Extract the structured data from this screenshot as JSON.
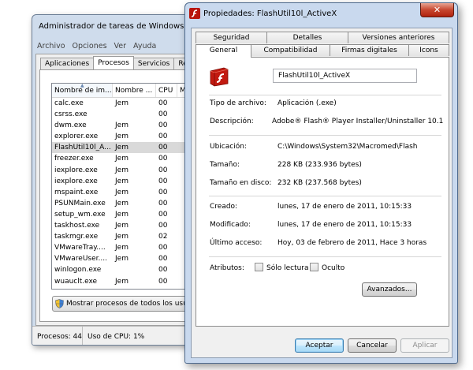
{
  "task_manager": {
    "title": "Administrador de tareas de Windows",
    "menu": [
      "Archivo",
      "Opciones",
      "Ver",
      "Ayuda"
    ],
    "tabs": [
      "Aplicaciones",
      "Procesos",
      "Servicios",
      "Rendim"
    ],
    "active_tab": "Procesos",
    "columns": [
      "Nombre de im...",
      "Nombre ...",
      "CPU",
      "M"
    ],
    "rows": [
      {
        "name": "calc.exe",
        "user": "Jem",
        "cpu": "00"
      },
      {
        "name": "csrss.exe",
        "user": "",
        "cpu": "00"
      },
      {
        "name": "dwm.exe",
        "user": "Jem",
        "cpu": "00"
      },
      {
        "name": "explorer.exe",
        "user": "Jem",
        "cpu": "00"
      },
      {
        "name": "FlashUtil10l_A...",
        "user": "Jem",
        "cpu": "00"
      },
      {
        "name": "freezer.exe",
        "user": "Jem",
        "cpu": "00"
      },
      {
        "name": "iexplore.exe",
        "user": "Jem",
        "cpu": "00"
      },
      {
        "name": "iexplore.exe",
        "user": "Jem",
        "cpu": "00"
      },
      {
        "name": "mspaint.exe",
        "user": "Jem",
        "cpu": "00"
      },
      {
        "name": "PSUNMain.exe",
        "user": "Jem",
        "cpu": "00"
      },
      {
        "name": "setup_wm.exe",
        "user": "Jem",
        "cpu": "00"
      },
      {
        "name": "taskhost.exe",
        "user": "Jem",
        "cpu": "00"
      },
      {
        "name": "taskmgr.exe",
        "user": "Jem",
        "cpu": "02"
      },
      {
        "name": "VMwareTray....",
        "user": "Jem",
        "cpu": "00"
      },
      {
        "name": "VMwareUser....",
        "user": "Jem",
        "cpu": "00"
      },
      {
        "name": "winlogon.exe",
        "user": "",
        "cpu": "00"
      },
      {
        "name": "wuauclt.exe",
        "user": "Jem",
        "cpu": "00"
      }
    ],
    "selected_row": 4,
    "show_all_button": "Mostrar procesos de todos los usuarios",
    "status": {
      "processes": "Procesos: 44",
      "cpu": "Uso de CPU: 1%"
    }
  },
  "properties": {
    "title": "Propiedades: FlashUtil10l_ActiveX",
    "close_glyph": "✕",
    "tabs_row1": [
      "Seguridad",
      "Detalles",
      "Versiones anteriores"
    ],
    "tabs_row2": [
      "General",
      "Compatibilidad",
      "Firmas digitales",
      "Icons"
    ],
    "active_tab": "General",
    "file_name": "FlashUtil10l_ActiveX",
    "fields": [
      {
        "label": "Tipo de archivo:",
        "value": "Aplicación (.exe)"
      },
      {
        "label": "Descripción:",
        "value": "Adobe® Flash® Player Installer/Uninstaller 10.1"
      },
      {
        "label": "Ubicación:",
        "value": "C:\\Windows\\System32\\Macromed\\Flash"
      },
      {
        "label": "Tamaño:",
        "value": "228 KB (233.936 bytes)"
      },
      {
        "label": "Tamaño en disco:",
        "value": "232 KB (237.568 bytes)"
      },
      {
        "label": "Creado:",
        "value": "lunes, 17 de enero de 2011, 10:15:33"
      },
      {
        "label": "Modificado:",
        "value": "lunes, 17 de enero de 2011, 10:15:33"
      },
      {
        "label": "Último acceso:",
        "value": "Hoy, 03 de febrero de 2011, Hace 3 horas"
      }
    ],
    "attributes_label": "Atributos:",
    "readonly_label": "Sólo lectura",
    "hidden_label": "Oculto",
    "advanced_button": "Avanzados...",
    "ok_button": "Aceptar",
    "cancel_button": "Cancelar",
    "apply_button": "Aplicar"
  }
}
